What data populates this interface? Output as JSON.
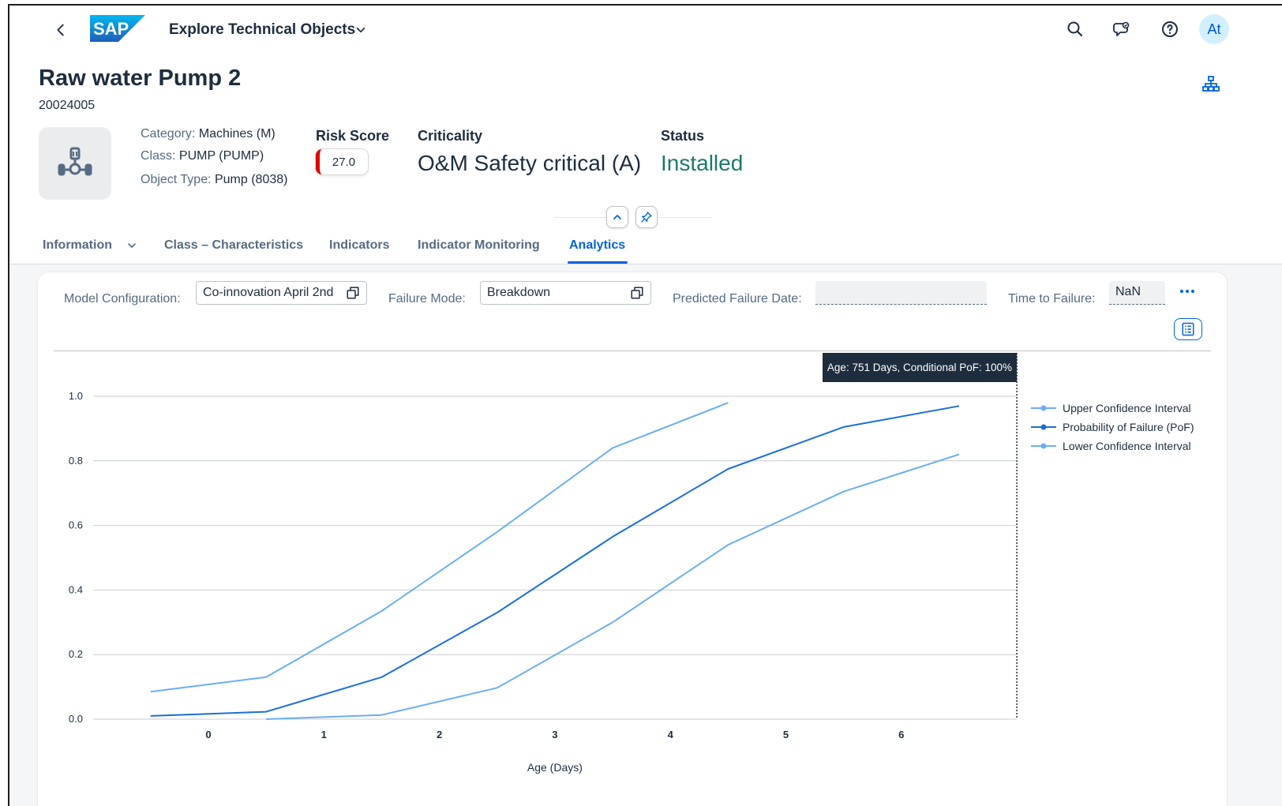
{
  "shell": {
    "app_title": "Explore Technical Objects",
    "logo_text": "SAP",
    "avatar_initials": "At"
  },
  "header": {
    "title": "Raw water Pump 2",
    "id": "20024005",
    "attributes": [
      {
        "label": "Category:",
        "value": "Machines (M)"
      },
      {
        "label": "Class:",
        "value": "PUMP (PUMP)"
      },
      {
        "label": "Object Type:",
        "value": "Pump (8038)"
      }
    ],
    "risk_score": {
      "label": "Risk Score",
      "value": "27.0"
    },
    "criticality": {
      "label": "Criticality",
      "value": "O&M Safety critical (A)"
    },
    "status": {
      "label": "Status",
      "value": "Installed"
    }
  },
  "tabs": [
    {
      "label": "Information"
    },
    {
      "label": "Class – Characteristics"
    },
    {
      "label": "Indicators"
    },
    {
      "label": "Indicator Monitoring"
    },
    {
      "label": "Analytics"
    }
  ],
  "filters": {
    "model_configuration": {
      "label": "Model Configuration:",
      "value": "Co-innovation April 2nd"
    },
    "failure_mode": {
      "label": "Failure Mode:",
      "value": "Breakdown"
    },
    "predicted_failure_date": {
      "label": "Predicted Failure Date:",
      "value": ""
    },
    "time_to_failure": {
      "label": "Time to Failure:",
      "value": "NaN"
    }
  },
  "tooltip": "Age: 751 Days, Conditional PoF: 100%",
  "colors": {
    "accent": "#0064d9",
    "pof_line": "#1b6fd9",
    "ci_line": "#6aaef2",
    "risk_indicator": "#e00000",
    "status_installed": "#1a7a6d"
  },
  "chart_data": {
    "type": "line",
    "xlabel": "Age (Days)",
    "ylabel": "",
    "x_ticks": [
      "0",
      "1",
      "2",
      "3",
      "4",
      "5",
      "6"
    ],
    "y_ticks": [
      "0.0",
      "0.2",
      "0.4",
      "0.6",
      "0.8",
      "1.0"
    ],
    "ylim": [
      0,
      1.1
    ],
    "grid": true,
    "legend_position": "right",
    "series": [
      {
        "name": "Upper Confidence Interval",
        "color": "#6aaef2",
        "x": [
          -0.5,
          0.5,
          1.5,
          2.5,
          3.5,
          4.5
        ],
        "values": [
          0.085,
          0.13,
          0.335,
          0.58,
          0.84,
          0.98
        ]
      },
      {
        "name": "Probability of Failure (PoF)",
        "color": "#1b6fd9",
        "x": [
          -0.5,
          0.5,
          1.5,
          2.5,
          3.5,
          4.5,
          5.5,
          6.5
        ],
        "values": [
          0.01,
          0.023,
          0.13,
          0.33,
          0.565,
          0.775,
          0.905,
          0.97
        ]
      },
      {
        "name": "Lower Confidence Interval",
        "color": "#6aaef2",
        "x": [
          0.5,
          1.5,
          2.5,
          3.5,
          4.5,
          5.5,
          6.5
        ],
        "values": [
          0.0,
          0.013,
          0.097,
          0.3,
          0.54,
          0.705,
          0.82
        ]
      }
    ],
    "marker_line_x": 7.0
  }
}
